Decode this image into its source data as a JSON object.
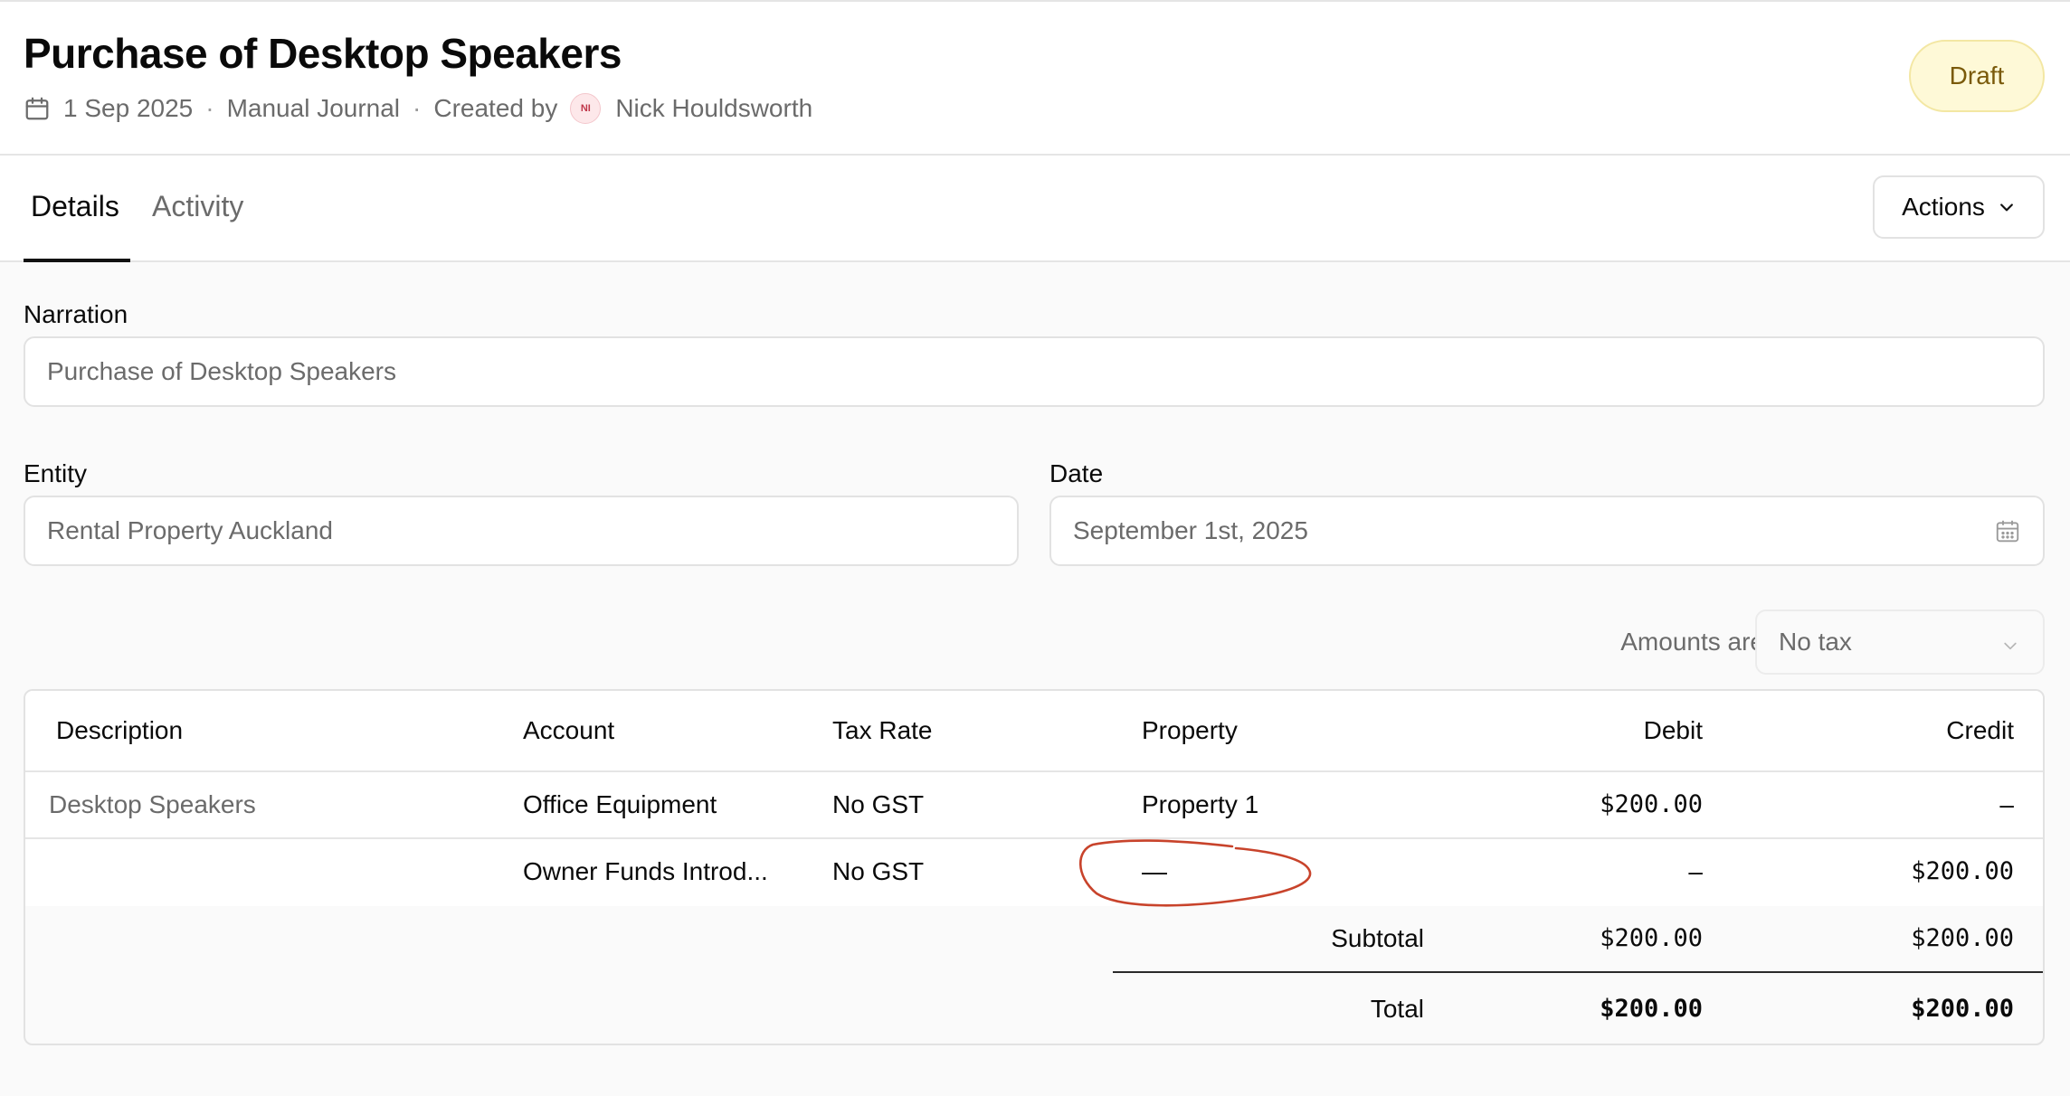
{
  "header": {
    "title": "Purchase of Desktop Speakers",
    "date": "1 Sep 2025",
    "separator": "·",
    "type": "Manual Journal",
    "created_by_label": "Created by",
    "avatar_initials": "NI",
    "creator": "Nick Houldsworth",
    "status": "Draft"
  },
  "tabs": [
    {
      "label": "Details",
      "active": true
    },
    {
      "label": "Activity",
      "active": false
    }
  ],
  "actions_label": "Actions",
  "form": {
    "narration_label": "Narration",
    "narration_value": "Purchase of Desktop Speakers",
    "entity_label": "Entity",
    "entity_value": "Rental Property Auckland",
    "date_label": "Date",
    "date_value": "September 1st, 2025",
    "amounts_label": "Amounts are",
    "amounts_value": "No tax"
  },
  "table": {
    "columns": [
      "Description",
      "Account",
      "Tax Rate",
      "Property",
      "Debit",
      "Credit"
    ],
    "rows": [
      {
        "description": "Desktop Speakers",
        "account": "Office Equipment",
        "tax_rate": "No GST",
        "property": "Property 1",
        "debit": "$200.00",
        "credit": "–"
      },
      {
        "description": "",
        "account": "Owner Funds Introd...",
        "tax_rate": "No GST",
        "property": "—",
        "debit": "–",
        "credit": "$200.00"
      }
    ],
    "subtotal": {
      "label": "Subtotal",
      "debit": "$200.00",
      "credit": "$200.00"
    },
    "total": {
      "label": "Total",
      "debit": "$200.00",
      "credit": "$200.00"
    }
  },
  "colors": {
    "badge_bg": "#fef9d7",
    "badge_text": "#7a5a0a",
    "annotation": "#c8432b"
  }
}
